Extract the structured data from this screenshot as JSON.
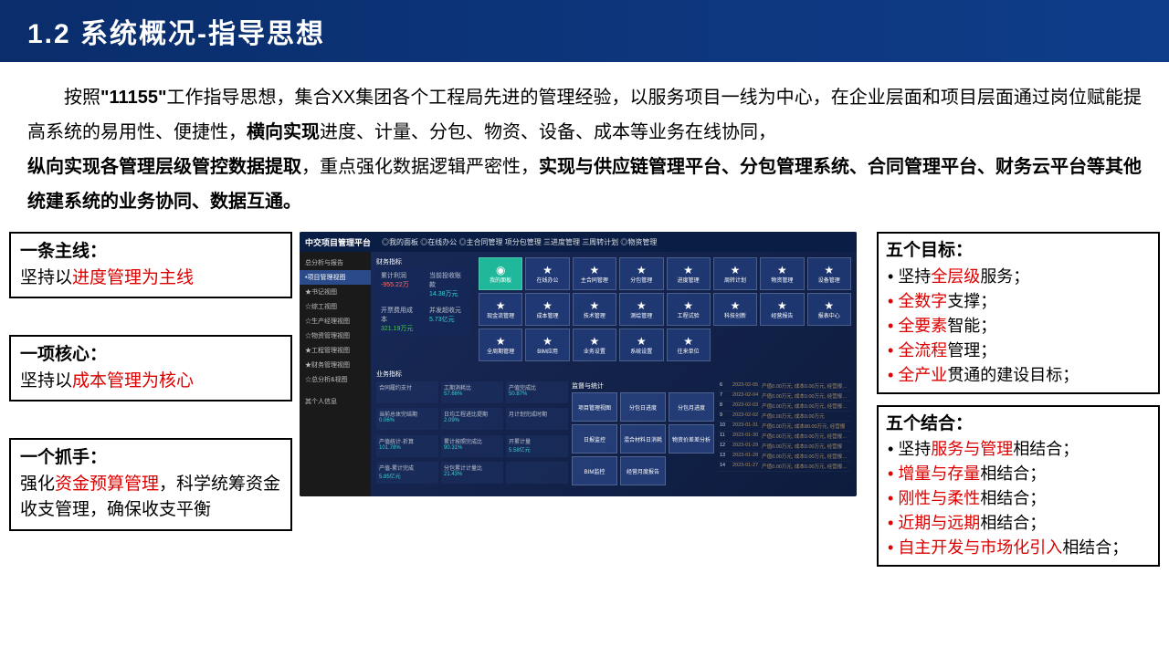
{
  "header": "1.2 系统概况-指导思想",
  "para": {
    "p1a": "按照",
    "p1b": "\"11155\"",
    "p1c": "工作指导思想，集合XX集团各个工程局先进的管理经验，以服务项目一线为中心，在企业层面和项目层面通过岗位赋能提高系统的易用性、便捷性，",
    "p1d": "横向实现",
    "p1e": "进度、计量、分包、物资、设备、成本等业务在线协同，",
    "p1f": "纵向实现各管理层级管控数据提取",
    "p1g": "，重点强化数据逻辑严密性，",
    "p1h": "实现与供应链管理平台、分包管理系统、合同管理平台、财务云平台等其他统建系统的业务协同、数据互通。"
  },
  "left": {
    "b1": {
      "t": "一条主线：",
      "a": "坚持以",
      "r": "进度管理为主线"
    },
    "b2": {
      "t": "一项核心：",
      "a": "坚持以",
      "r": "成本管理为核心"
    },
    "b3": {
      "t": "一个抓手：",
      "a": "强化",
      "r": "资金预算管理",
      "b": "，科学统筹资金收支管理，确保收支平衡"
    }
  },
  "dash": {
    "brand": "中交项目管理平台",
    "tabs": [
      "◎我的面板",
      "◎在线办公",
      "◎主合同管理",
      "项分包管理",
      "三进度管理",
      "三周转计划",
      "◎物资管理"
    ],
    "side_top": "总分析与报告",
    "side": [
      "•项目管理视图",
      "★书记视图",
      "☆综工视图",
      "☆生产经理视图",
      "☆物资管理视图",
      "★工程管理视图",
      "★财务管理视图",
      "☆总分析&视图"
    ],
    "side_bot": "其个人信息",
    "fin_label": "财务指标",
    "fin": [
      {
        "l": "累计利润",
        "v": "-955.22万",
        "c": "m-red"
      },
      {
        "l": "当前投收账款",
        "v": "14.38万元",
        "c": "m-cyan"
      },
      {
        "l": "开票费用成本",
        "v": "321.19万元",
        "c": "m-green"
      },
      {
        "l": "并发超收元",
        "v": "5.73亿元",
        "c": "m-cyan"
      }
    ],
    "icons_r1": [
      "我的面板",
      "在线办公",
      "主合同管理",
      "分包管理",
      "进度管理",
      "周转计划",
      "物资管理",
      "设备管理"
    ],
    "icons_r2": [
      "现金流管理",
      "成本管理",
      "技术管理",
      "测绘管理",
      "工程试验",
      "科技创新",
      "经营报告",
      "报表中心"
    ],
    "icons_r3": [
      "全周期管理",
      "BIM应用",
      "业务设置",
      "系统设置",
      "往来单位"
    ],
    "biz_label": "业务指标",
    "stats": [
      {
        "l": "合同履约支付",
        "v": ""
      },
      {
        "l": "工期消耗比",
        "v": "57.66%"
      },
      {
        "l": "产值完成比",
        "v": "50.87%"
      },
      {
        "l": "当前总体完结期",
        "v": "0.06%"
      },
      {
        "l": "日均工程进比提期",
        "v": "2.09%"
      },
      {
        "l": "月计划完成时期",
        "v": ""
      },
      {
        "l": "产值统计-折算",
        "v": "101.78%"
      },
      {
        "l": "累计按照完成比",
        "v": "90.31%"
      },
      {
        "l": "开累计量",
        "v": "5.58亿元"
      },
      {
        "l": "产值-累计完成",
        "v": "5.85亿元"
      },
      {
        "l": "分包累计计量比",
        "v": "21.43%"
      },
      {
        "l": "",
        "v": ""
      }
    ],
    "mid_label": "监督与统计",
    "mid": [
      "项目管理视图",
      "分包日进度",
      "分包月进度",
      "日报监控",
      "混合材料日消耗",
      "物资价差差分析",
      "BIM监控",
      "经营月度报告"
    ],
    "logs": [
      {
        "n": "6",
        "d": "2023-02-05",
        "t": "产值0.00万元, 成本0.00万元, 经营报…"
      },
      {
        "n": "7",
        "d": "2023-02-04",
        "t": "产值0.00万元, 成本0.00万元, 经营报…"
      },
      {
        "n": "8",
        "d": "2023-02-03",
        "t": "产值0.00万元, 成本0.00万元, 经营报…"
      },
      {
        "n": "9",
        "d": "2023-02-02",
        "t": "产值0.00万元, 成本0.00万元"
      },
      {
        "n": "10",
        "d": "2023-01-31",
        "t": "产值0.00万元, 成本80.00万元, 经营报"
      },
      {
        "n": "11",
        "d": "2023-01-30",
        "t": "产值0.00万元, 成本0.00万元, 经营报…"
      },
      {
        "n": "12",
        "d": "2023-01-29",
        "t": "产值0.00万元, 成本0.00万元, 经营报"
      },
      {
        "n": "13",
        "d": "2023-01-28",
        "t": "产值0.00万元, 成本0.00万元, 经营报…"
      },
      {
        "n": "14",
        "d": "2023-01-27",
        "t": "产值0.00万元, 成本0.00万元, 经营报…"
      }
    ]
  },
  "right": {
    "g1": {
      "t": "五个目标：",
      "items": [
        {
          "a": "坚持",
          "r": "全层级",
          "b": "服务；"
        },
        {
          "a": "",
          "r": "全数字",
          "b": "支撑；",
          "rl": true
        },
        {
          "a": "",
          "r": "全要素",
          "b": "智能；",
          "rl": true
        },
        {
          "a": "",
          "r": "全流程",
          "b": "管理；",
          "rl": true
        },
        {
          "a": "",
          "r": "全产业",
          "b": "贯通的建设目标；",
          "rl": true
        }
      ]
    },
    "g2": {
      "t": "五个结合：",
      "items": [
        {
          "a": "坚持",
          "r": "服务与管理",
          "b": "相结合；"
        },
        {
          "a": "",
          "r": "增量与存量",
          "b": "相结合；",
          "rl": true
        },
        {
          "a": "",
          "r": "刚性与柔性",
          "b": "相结合；",
          "rl": true
        },
        {
          "a": "",
          "r": "近期与远期",
          "b": "相结合；",
          "rl": true
        },
        {
          "a": "",
          "r": "自主开发与市场化引入",
          "b": "相结合；",
          "rl": true
        }
      ]
    }
  }
}
